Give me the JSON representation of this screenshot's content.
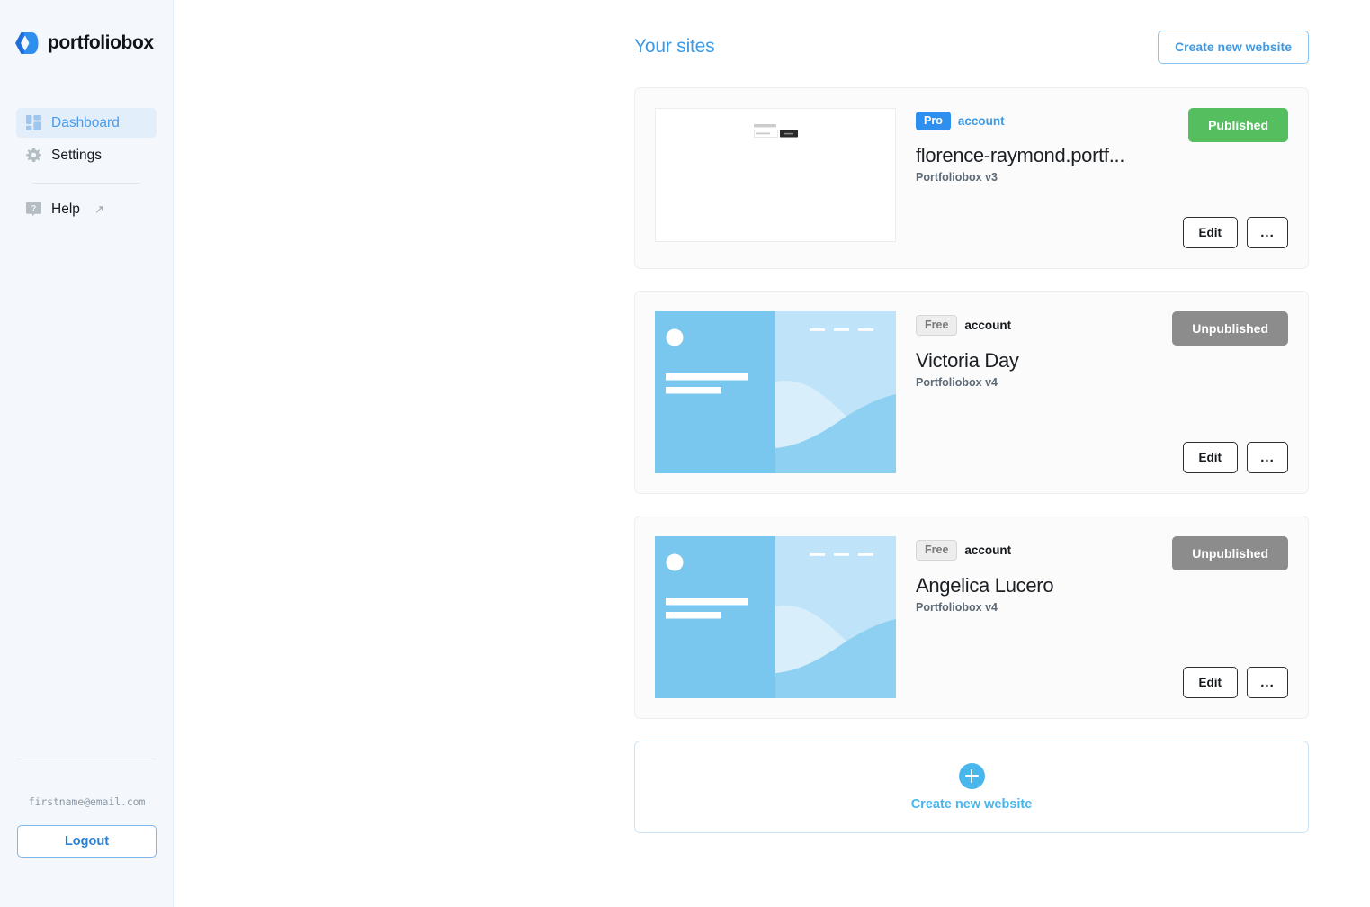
{
  "brand": {
    "name": "portfoliobox",
    "logo_icon": "portfoliobox-logo-icon"
  },
  "sidebar": {
    "items": [
      {
        "label": "Dashboard",
        "icon": "dashboard-grid-icon",
        "active": true
      },
      {
        "label": "Settings",
        "icon": "gear-icon",
        "active": false
      }
    ],
    "help": {
      "label": "Help",
      "icon": "question-bubble-icon",
      "external_icon": "external-link-arrow-icon"
    },
    "account": {
      "email": "firstname@email.com",
      "logout_label": "Logout"
    }
  },
  "header": {
    "title": "Your sites",
    "create_button_label": "Create new website"
  },
  "sites": [
    {
      "account_badge": "Pro",
      "account_word": "account",
      "account_tier": "pro",
      "name": "florence-raymond.portf...",
      "version": "Portfoliobox v3",
      "status_label": "Published",
      "status": "published",
      "edit_label": "Edit",
      "more_label": "...",
      "thumbnail": "login-form-preview"
    },
    {
      "account_badge": "Free",
      "account_word": "account",
      "account_tier": "free",
      "name": "Victoria Day",
      "version": "Portfoliobox v4",
      "status_label": "Unpublished",
      "status": "unpublished",
      "edit_label": "Edit",
      "more_label": "...",
      "thumbnail": "blue-placeholder-preview"
    },
    {
      "account_badge": "Free",
      "account_word": "account",
      "account_tier": "free",
      "name": "Angelica Lucero",
      "version": "Portfoliobox v4",
      "status_label": "Unpublished",
      "status": "unpublished",
      "edit_label": "Edit",
      "more_label": "...",
      "thumbnail": "blue-placeholder-preview"
    }
  ],
  "create_card": {
    "label": "Create new website",
    "icon": "plus-circle-icon"
  },
  "colors": {
    "accent_blue": "#3f9ae5",
    "brand_blue": "#2f8fee",
    "published_green": "#55bf5f",
    "unpublished_gray": "#8c8c8c",
    "sidebar_bg": "#f4f8fc",
    "active_nav_bg": "#e3eefb",
    "card_bg": "#fbfbfb",
    "thumb_blue_dark": "#79c7ef",
    "thumb_blue_light": "#bfe3f8"
  }
}
